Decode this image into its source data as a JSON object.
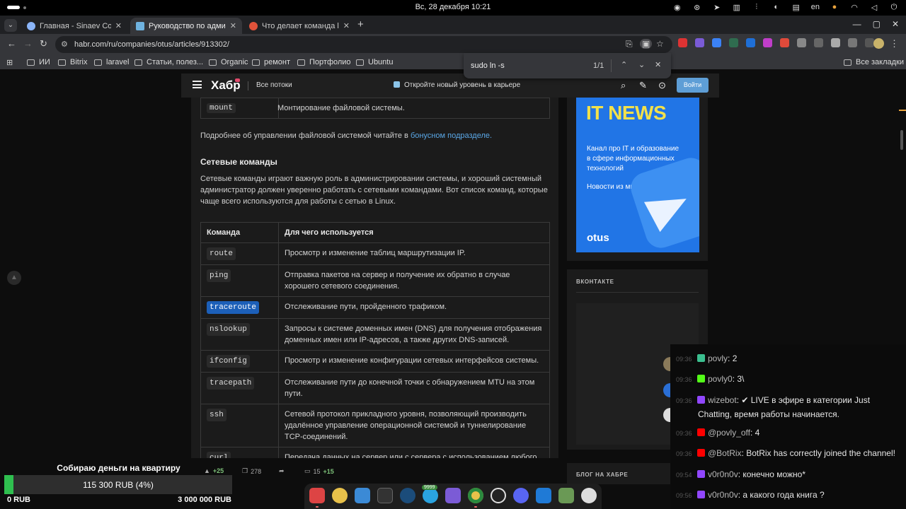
{
  "system": {
    "clock": "Вс, 28 декабря  10:21",
    "lang": "en"
  },
  "browser": {
    "tabs": [
      {
        "label": "Главная - Sinaev Compa",
        "favicon_color": "#8ab4f8"
      },
      {
        "label": "Руководство по админ",
        "favicon_color": "#6fb3e0"
      },
      {
        "label": "Что делает команда ln?",
        "favicon_color": "#e0523a"
      }
    ],
    "url": "habr.com/ru/companies/otus/articles/913302/",
    "bookmarks": [
      "ИИ",
      "Bitrix",
      "laravel",
      "Статьи, полез...",
      "Organic",
      "ремонт",
      "Портфолио",
      "Ubuntu"
    ],
    "all_bookmarks": "Все закладки",
    "find": {
      "query": "sudo ln -s",
      "count": "1/1"
    }
  },
  "habr": {
    "logo": "Хабр",
    "all_flows": "Все потоки",
    "promo": "Откройте новый уровень в карьере",
    "login": "Войти"
  },
  "article": {
    "mount_cmd": "mount",
    "mount_desc": "Монтирование файловой системы.",
    "fs_text_before": "Подробнее об управлении файловой системой читайте в ",
    "fs_link": "бонусном подразделе.",
    "network_heading": "Сетевые команды",
    "network_intro": "Сетевые команды играют важную роль в администрировании системы, и хороший системный администратор должен уверенно работать с сетевыми командами. Вот список команд, которые чаще всего используются для работы с сетью в Linux.",
    "table_headers": [
      "Команда",
      "Для чего используется"
    ],
    "rows": [
      {
        "cmd": "route",
        "desc": "Просмотр и изменение таблиц маршрутизации IP."
      },
      {
        "cmd": "ping",
        "desc": "Отправка пакетов на сервер и получение их обратно в случае хорошего сетевого соединения."
      },
      {
        "cmd": "traceroute",
        "desc": "Отслеживание пути, пройденного трафиком."
      },
      {
        "cmd": "nslookup",
        "desc": "Запросы к системе доменных имен (DNS) для получения отображения доменных имен или IP-адресов, а также других DNS-записей."
      },
      {
        "cmd": "ifconfig",
        "desc": "Просмотр и изменение конфигурации сетевых интерфейсов системы."
      },
      {
        "cmd": "tracepath",
        "desc": "Отслеживание пути до конечной точки с обнаружением MTU на этом пути."
      },
      {
        "cmd": "ssh",
        "desc": "Сетевой протокол прикладного уровня, позволяющий производить удалённое управление операционной системой и туннелирование TCP-соединений."
      },
      {
        "cmd": "curl",
        "desc": "Передача данных на сервер или с сервера с использованием любого из поддерживаемых протоколов."
      }
    ],
    "stats": {
      "rating": "+25",
      "bookmarks": "278",
      "comments": "15",
      "comments_new": "+15"
    }
  },
  "sidebar": {
    "ad_title": "IT NEWS",
    "ad_sub": "Канал про IT и образование в сфере информационных технологий",
    "ad_sub2": "Новости из мира IT",
    "ad_brand": "otus",
    "vk_heading": "ВКОНТАКТЕ",
    "blog_heading": "БЛОГ НА ХАБРЕ"
  },
  "chat": [
    {
      "time": "09:36",
      "nick": "povly",
      "text": "2",
      "badge": "#3bbf8f"
    },
    {
      "time": "09:36",
      "nick": "povly0",
      "text": "3\\",
      "badge": "#53fc18"
    },
    {
      "time": "09:36",
      "nick": "wizebot",
      "text": "✔ LIVE в эфире в категории Just",
      "cont": "Chatting, время работы начинается.",
      "badge": "#9147ff"
    },
    {
      "time": "09:36",
      "nick": "@povly_off",
      "text": "4",
      "badge": "#ff0000"
    },
    {
      "time": "09:36",
      "nick": "@BotRix",
      "text": "BotRix has correctly joined the channel!",
      "badge": "#ff0000"
    },
    {
      "time": "09:54",
      "nick": "v0r0n0v",
      "text": "конечно можно*",
      "badge": "#9147ff"
    },
    {
      "time": "09:56",
      "nick": "v0r0n0v",
      "text": "а какого года книга ?",
      "badge": "#9147ff"
    }
  ],
  "donation": {
    "goal": "Собираю деньги на квартиру",
    "amount": "115 300 RUB (4%)",
    "progress_pct": 4,
    "min": "0 RUB",
    "max": "3 000 000 RUB"
  },
  "dock": {
    "steam_badge": "9999"
  }
}
